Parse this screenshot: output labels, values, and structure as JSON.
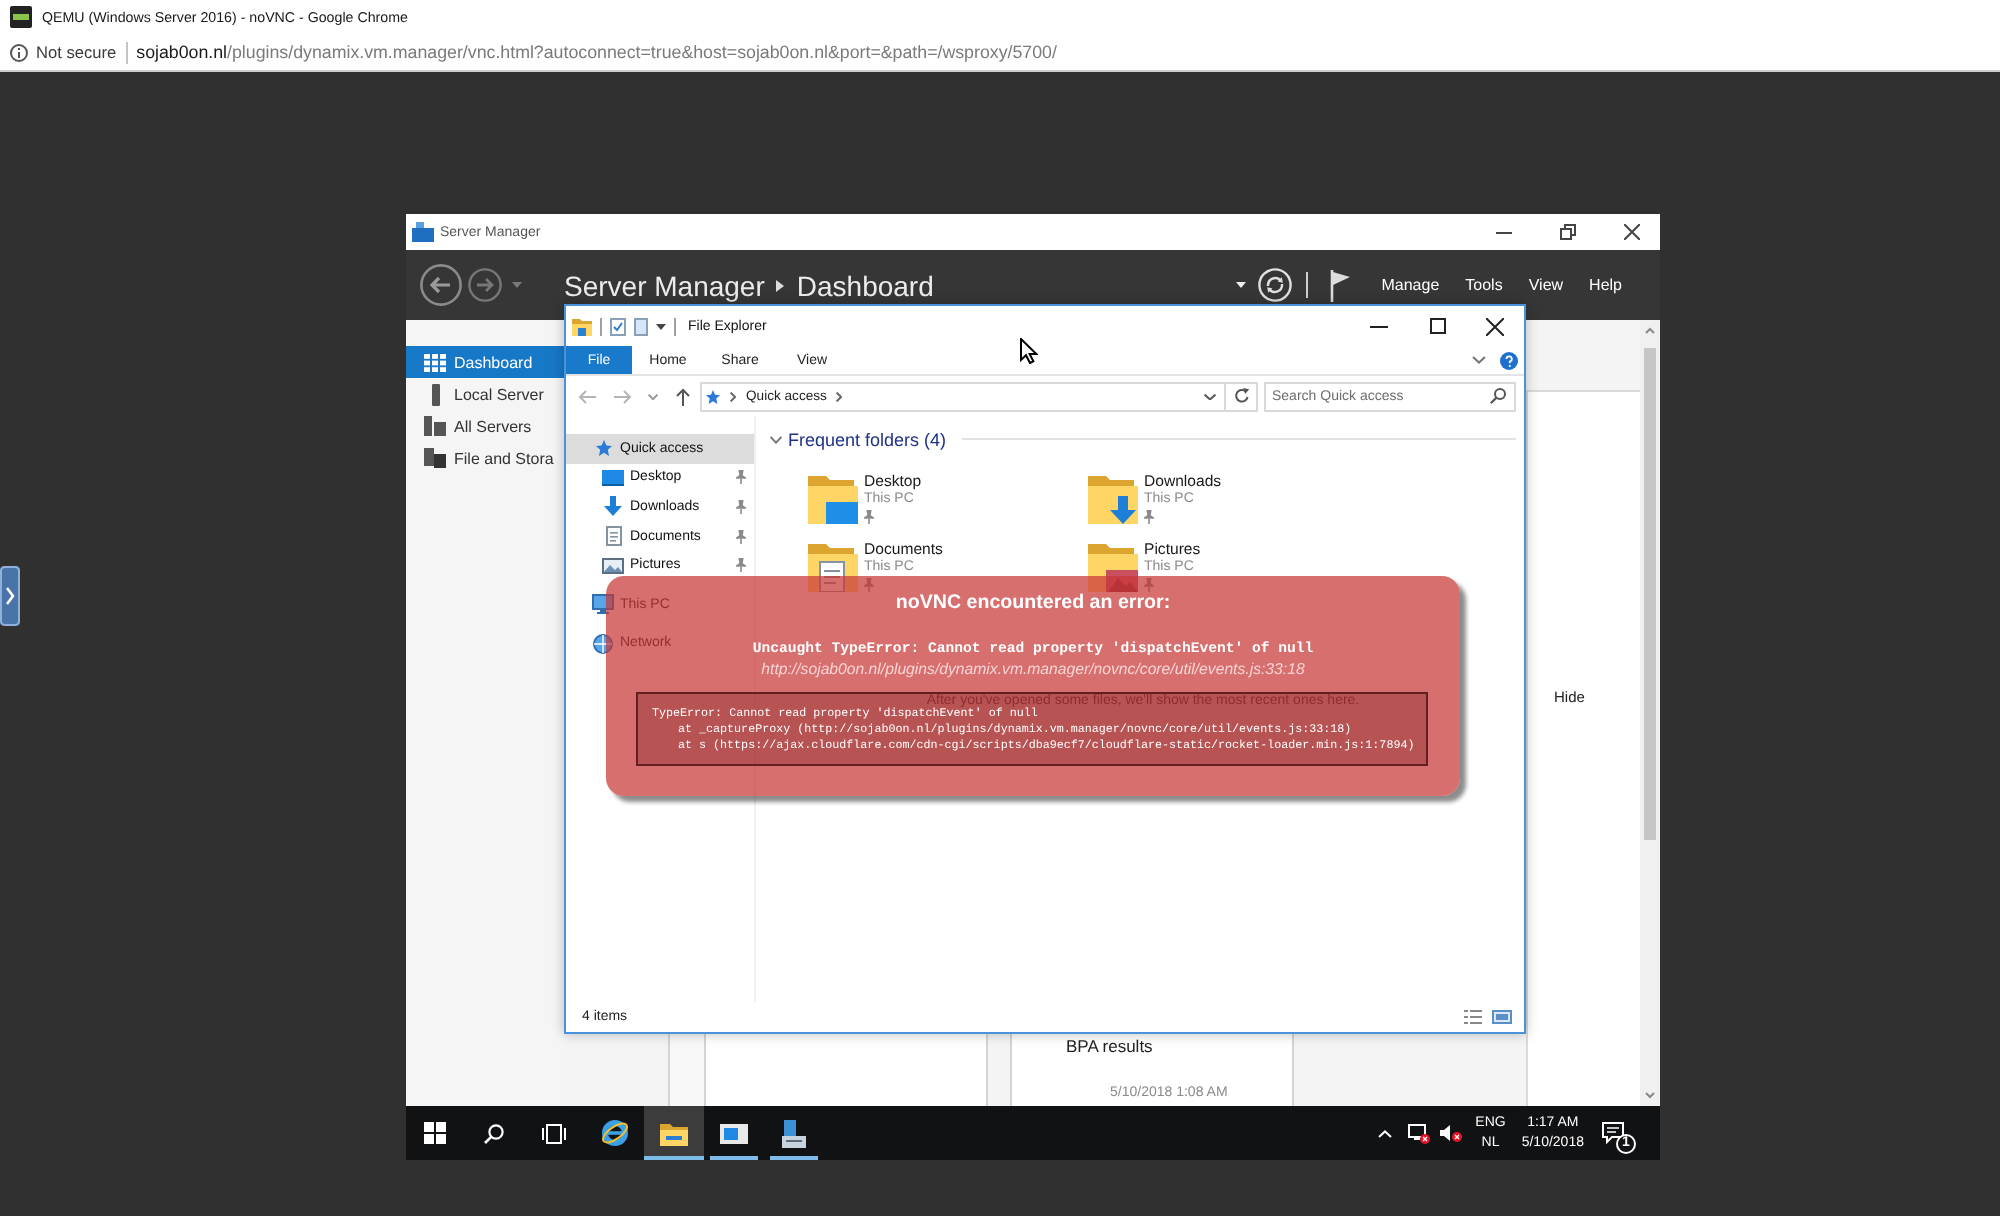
{
  "browser": {
    "title": "QEMU (Windows Server 2016) - noVNC - Google Chrome",
    "security": "Not secure",
    "url_host": "sojab0on.nl",
    "url_path": "/plugins/dynamix.vm.manager/vnc.html?autoconnect=true&host=sojab0on.nl&port=&path=/wsproxy/5700/"
  },
  "server_manager": {
    "title": "Server Manager",
    "breadcrumb": [
      "Server Manager",
      "Dashboard"
    ],
    "menu": [
      "Manage",
      "Tools",
      "View",
      "Help"
    ],
    "nav": [
      {
        "label": "Dashboard",
        "kind": "dashboard",
        "selected": true
      },
      {
        "label": "Local Server",
        "kind": "server",
        "selected": false
      },
      {
        "label": "All Servers",
        "kind": "servers",
        "selected": false
      },
      {
        "label": "File and Stora",
        "kind": "storage",
        "selected": false
      }
    ],
    "welcome_panel": {
      "link": "Hide"
    },
    "bpa_tile": {
      "title": "BPA results",
      "time": "5/10/2018 1:08 AM"
    }
  },
  "file_explorer": {
    "title": "File Explorer",
    "ribbon_tabs": [
      {
        "label": "File",
        "kind": "file"
      },
      {
        "label": "Home",
        "kind": "tab"
      },
      {
        "label": "Share",
        "kind": "tab"
      },
      {
        "label": "View",
        "kind": "tab"
      }
    ],
    "address": [
      "Quick access"
    ],
    "search": {
      "placeholder": "Search Quick access"
    },
    "nav": [
      {
        "label": "Quick access",
        "kind": "star",
        "selected": true,
        "children": [
          {
            "label": "Desktop",
            "kind": "desktop",
            "pinned": true,
            "selected": false
          },
          {
            "label": "Downloads",
            "kind": "downloads",
            "pinned": true,
            "selected": false
          },
          {
            "label": "Documents",
            "kind": "documents",
            "pinned": true,
            "selected": false
          },
          {
            "label": "Pictures",
            "kind": "pictures",
            "pinned": true,
            "selected": false
          }
        ]
      },
      {
        "label": "This PC",
        "kind": "pc",
        "selected": false
      },
      {
        "label": "Network",
        "kind": "network",
        "selected": false
      }
    ],
    "section": {
      "heading": "Frequent folders (4)",
      "expanded": true,
      "folders": [
        {
          "name": "Desktop",
          "location": "This PC",
          "kind": "desktop",
          "pinned": true
        },
        {
          "name": "Downloads",
          "location": "This PC",
          "kind": "downloads",
          "pinned": true
        },
        {
          "name": "Documents",
          "location": "This PC",
          "kind": "documents",
          "pinned": true
        },
        {
          "name": "Pictures",
          "location": "This PC",
          "kind": "pictures",
          "pinned": true
        }
      ]
    },
    "recent_message": "After you've opened some files, we'll show the most recent ones here.",
    "status": "4 items"
  },
  "error": {
    "title": "noVNC encountered an error:",
    "message": "Uncaught TypeError: Cannot read property 'dispatchEvent' of null",
    "source": "http://sojab0on.nl/plugins/dynamix.vm.manager/novnc/core/util/events.js:33:18",
    "stack": {
      "error": "TypeError: Cannot read property 'dispatchEvent' of null",
      "frames": [
        "at _captureProxy (http://sojab0on.nl/plugins/dynamix.vm.manager/novnc/core/util/events.js:33:18)",
        "at s (https://ajax.cloudflare.com/cdn-cgi/scripts/dba9ecf7/cloudflare-static/rocket-loader.min.js:1:7894)"
      ]
    }
  },
  "taskbar": {
    "apps": [
      {
        "kind": "browser",
        "running": false,
        "selected": false
      },
      {
        "kind": "explorer",
        "running": true,
        "selected": true
      },
      {
        "kind": "window",
        "running": true,
        "selected": false
      },
      {
        "kind": "server-manager",
        "running": true,
        "selected": false
      }
    ],
    "language": "ENG",
    "layout": "NL",
    "time": "1:17 AM",
    "date": "5/10/2018",
    "notifications": "1"
  }
}
